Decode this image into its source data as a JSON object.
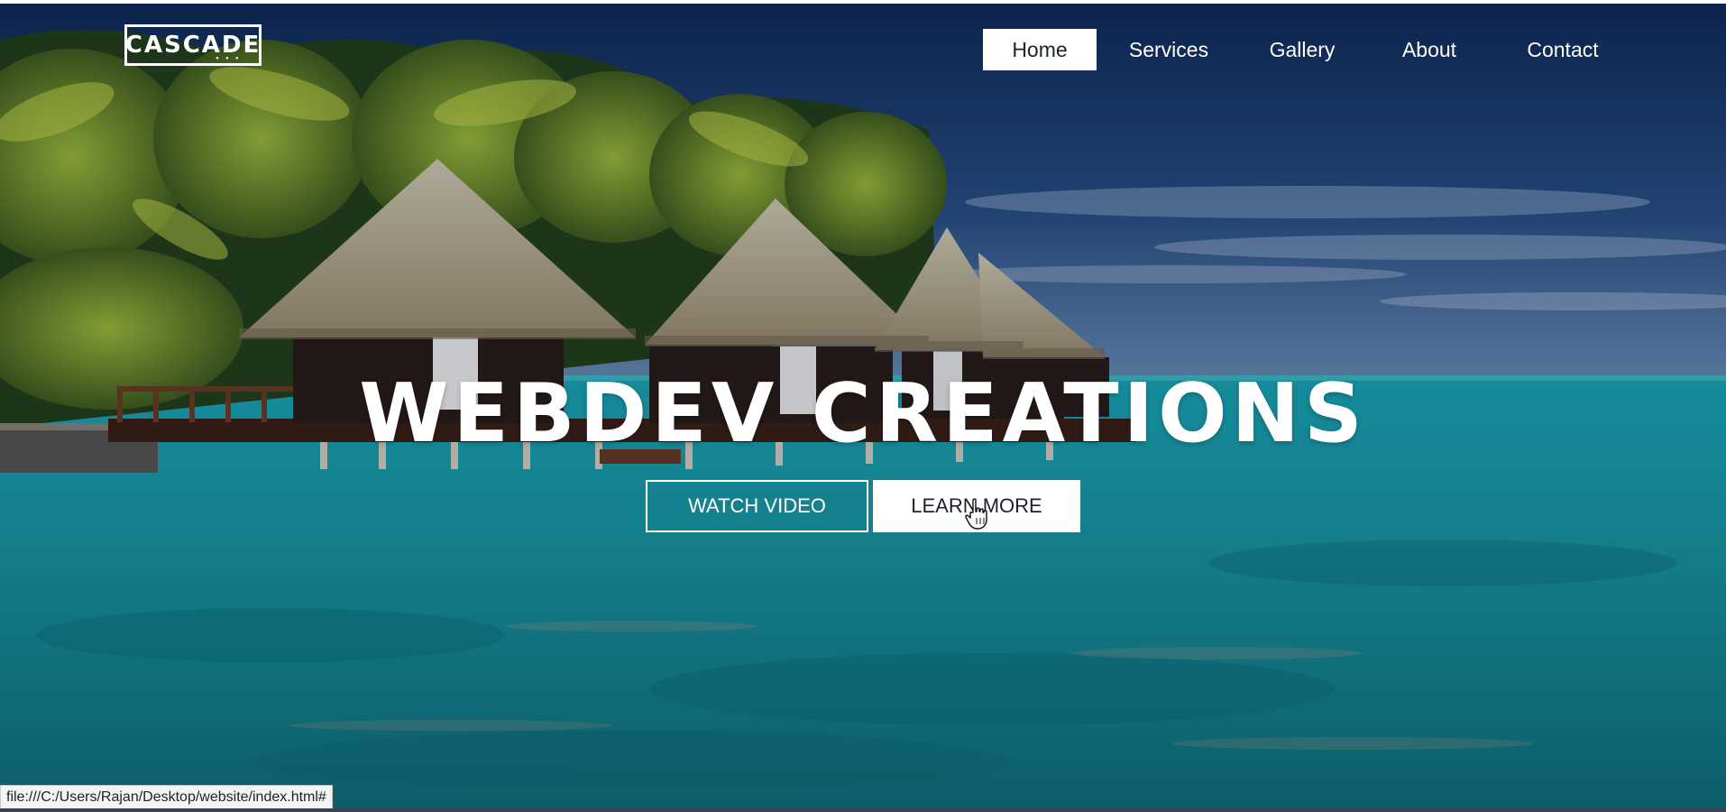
{
  "brand": {
    "logo_text": "CASCADE",
    "logo_dots": "• • •"
  },
  "nav": {
    "items": [
      {
        "label": "Home",
        "active": true
      },
      {
        "label": "Services",
        "active": false
      },
      {
        "label": "Gallery",
        "active": false
      },
      {
        "label": "About",
        "active": false
      },
      {
        "label": "Contact",
        "active": false
      }
    ]
  },
  "hero": {
    "title": "WEBDEV CREATIONS",
    "primary_button": "WATCH VIDEO",
    "secondary_button": "LEARN MORE",
    "background_image": "tropical-beach-overwater-bungalows"
  },
  "status_bar": {
    "url": "file:///C:/Users/Rajan/Desktop/website/index.html#"
  },
  "colors": {
    "sky_top": "#14305e",
    "sea": "#1b8a96",
    "text_dark": "#1b2230",
    "white": "#ffffff"
  },
  "icons": {
    "cursor": "hand-pointer-icon"
  }
}
